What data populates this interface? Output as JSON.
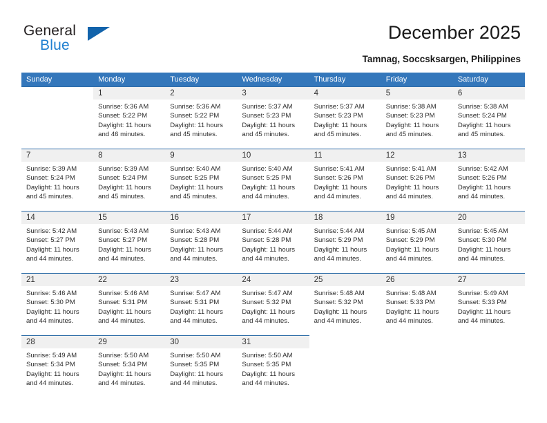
{
  "brand": {
    "name_top": "General",
    "name_bottom": "Blue",
    "triangle_color": "#1263ab",
    "blue_color": "#1f7fd0"
  },
  "header": {
    "title": "December 2025",
    "subtitle": "Tamnag, Soccsksargen, Philippines"
  },
  "theme": {
    "header_blue": "#3477bb",
    "divider_blue": "#2e6da8",
    "daynum_band": "#f0f0f0"
  },
  "weekdays": [
    "Sunday",
    "Monday",
    "Tuesday",
    "Wednesday",
    "Thursday",
    "Friday",
    "Saturday"
  ],
  "labels": {
    "sunrise_prefix": "Sunrise:",
    "sunset_prefix": "Sunset:",
    "daylight_prefix": "Daylight:"
  },
  "weeks": [
    [
      {
        "day": "",
        "empty": true
      },
      {
        "day": "1",
        "sunrise": "Sunrise: 5:36 AM",
        "sunset": "Sunset: 5:22 PM",
        "daylight_1": "Daylight: 11 hours",
        "daylight_2": "and 46 minutes."
      },
      {
        "day": "2",
        "sunrise": "Sunrise: 5:36 AM",
        "sunset": "Sunset: 5:22 PM",
        "daylight_1": "Daylight: 11 hours",
        "daylight_2": "and 45 minutes."
      },
      {
        "day": "3",
        "sunrise": "Sunrise: 5:37 AM",
        "sunset": "Sunset: 5:23 PM",
        "daylight_1": "Daylight: 11 hours",
        "daylight_2": "and 45 minutes."
      },
      {
        "day": "4",
        "sunrise": "Sunrise: 5:37 AM",
        "sunset": "Sunset: 5:23 PM",
        "daylight_1": "Daylight: 11 hours",
        "daylight_2": "and 45 minutes."
      },
      {
        "day": "5",
        "sunrise": "Sunrise: 5:38 AM",
        "sunset": "Sunset: 5:23 PM",
        "daylight_1": "Daylight: 11 hours",
        "daylight_2": "and 45 minutes."
      },
      {
        "day": "6",
        "sunrise": "Sunrise: 5:38 AM",
        "sunset": "Sunset: 5:24 PM",
        "daylight_1": "Daylight: 11 hours",
        "daylight_2": "and 45 minutes."
      }
    ],
    [
      {
        "day": "7",
        "sunrise": "Sunrise: 5:39 AM",
        "sunset": "Sunset: 5:24 PM",
        "daylight_1": "Daylight: 11 hours",
        "daylight_2": "and 45 minutes."
      },
      {
        "day": "8",
        "sunrise": "Sunrise: 5:39 AM",
        "sunset": "Sunset: 5:24 PM",
        "daylight_1": "Daylight: 11 hours",
        "daylight_2": "and 45 minutes."
      },
      {
        "day": "9",
        "sunrise": "Sunrise: 5:40 AM",
        "sunset": "Sunset: 5:25 PM",
        "daylight_1": "Daylight: 11 hours",
        "daylight_2": "and 45 minutes."
      },
      {
        "day": "10",
        "sunrise": "Sunrise: 5:40 AM",
        "sunset": "Sunset: 5:25 PM",
        "daylight_1": "Daylight: 11 hours",
        "daylight_2": "and 44 minutes."
      },
      {
        "day": "11",
        "sunrise": "Sunrise: 5:41 AM",
        "sunset": "Sunset: 5:26 PM",
        "daylight_1": "Daylight: 11 hours",
        "daylight_2": "and 44 minutes."
      },
      {
        "day": "12",
        "sunrise": "Sunrise: 5:41 AM",
        "sunset": "Sunset: 5:26 PM",
        "daylight_1": "Daylight: 11 hours",
        "daylight_2": "and 44 minutes."
      },
      {
        "day": "13",
        "sunrise": "Sunrise: 5:42 AM",
        "sunset": "Sunset: 5:26 PM",
        "daylight_1": "Daylight: 11 hours",
        "daylight_2": "and 44 minutes."
      }
    ],
    [
      {
        "day": "14",
        "sunrise": "Sunrise: 5:42 AM",
        "sunset": "Sunset: 5:27 PM",
        "daylight_1": "Daylight: 11 hours",
        "daylight_2": "and 44 minutes."
      },
      {
        "day": "15",
        "sunrise": "Sunrise: 5:43 AM",
        "sunset": "Sunset: 5:27 PM",
        "daylight_1": "Daylight: 11 hours",
        "daylight_2": "and 44 minutes."
      },
      {
        "day": "16",
        "sunrise": "Sunrise: 5:43 AM",
        "sunset": "Sunset: 5:28 PM",
        "daylight_1": "Daylight: 11 hours",
        "daylight_2": "and 44 minutes."
      },
      {
        "day": "17",
        "sunrise": "Sunrise: 5:44 AM",
        "sunset": "Sunset: 5:28 PM",
        "daylight_1": "Daylight: 11 hours",
        "daylight_2": "and 44 minutes."
      },
      {
        "day": "18",
        "sunrise": "Sunrise: 5:44 AM",
        "sunset": "Sunset: 5:29 PM",
        "daylight_1": "Daylight: 11 hours",
        "daylight_2": "and 44 minutes."
      },
      {
        "day": "19",
        "sunrise": "Sunrise: 5:45 AM",
        "sunset": "Sunset: 5:29 PM",
        "daylight_1": "Daylight: 11 hours",
        "daylight_2": "and 44 minutes."
      },
      {
        "day": "20",
        "sunrise": "Sunrise: 5:45 AM",
        "sunset": "Sunset: 5:30 PM",
        "daylight_1": "Daylight: 11 hours",
        "daylight_2": "and 44 minutes."
      }
    ],
    [
      {
        "day": "21",
        "sunrise": "Sunrise: 5:46 AM",
        "sunset": "Sunset: 5:30 PM",
        "daylight_1": "Daylight: 11 hours",
        "daylight_2": "and 44 minutes."
      },
      {
        "day": "22",
        "sunrise": "Sunrise: 5:46 AM",
        "sunset": "Sunset: 5:31 PM",
        "daylight_1": "Daylight: 11 hours",
        "daylight_2": "and 44 minutes."
      },
      {
        "day": "23",
        "sunrise": "Sunrise: 5:47 AM",
        "sunset": "Sunset: 5:31 PM",
        "daylight_1": "Daylight: 11 hours",
        "daylight_2": "and 44 minutes."
      },
      {
        "day": "24",
        "sunrise": "Sunrise: 5:47 AM",
        "sunset": "Sunset: 5:32 PM",
        "daylight_1": "Daylight: 11 hours",
        "daylight_2": "and 44 minutes."
      },
      {
        "day": "25",
        "sunrise": "Sunrise: 5:48 AM",
        "sunset": "Sunset: 5:32 PM",
        "daylight_1": "Daylight: 11 hours",
        "daylight_2": "and 44 minutes."
      },
      {
        "day": "26",
        "sunrise": "Sunrise: 5:48 AM",
        "sunset": "Sunset: 5:33 PM",
        "daylight_1": "Daylight: 11 hours",
        "daylight_2": "and 44 minutes."
      },
      {
        "day": "27",
        "sunrise": "Sunrise: 5:49 AM",
        "sunset": "Sunset: 5:33 PM",
        "daylight_1": "Daylight: 11 hours",
        "daylight_2": "and 44 minutes."
      }
    ],
    [
      {
        "day": "28",
        "sunrise": "Sunrise: 5:49 AM",
        "sunset": "Sunset: 5:34 PM",
        "daylight_1": "Daylight: 11 hours",
        "daylight_2": "and 44 minutes."
      },
      {
        "day": "29",
        "sunrise": "Sunrise: 5:50 AM",
        "sunset": "Sunset: 5:34 PM",
        "daylight_1": "Daylight: 11 hours",
        "daylight_2": "and 44 minutes."
      },
      {
        "day": "30",
        "sunrise": "Sunrise: 5:50 AM",
        "sunset": "Sunset: 5:35 PM",
        "daylight_1": "Daylight: 11 hours",
        "daylight_2": "and 44 minutes."
      },
      {
        "day": "31",
        "sunrise": "Sunrise: 5:50 AM",
        "sunset": "Sunset: 5:35 PM",
        "daylight_1": "Daylight: 11 hours",
        "daylight_2": "and 44 minutes."
      },
      {
        "day": "",
        "empty": true
      },
      {
        "day": "",
        "empty": true
      },
      {
        "day": "",
        "empty": true
      }
    ]
  ]
}
